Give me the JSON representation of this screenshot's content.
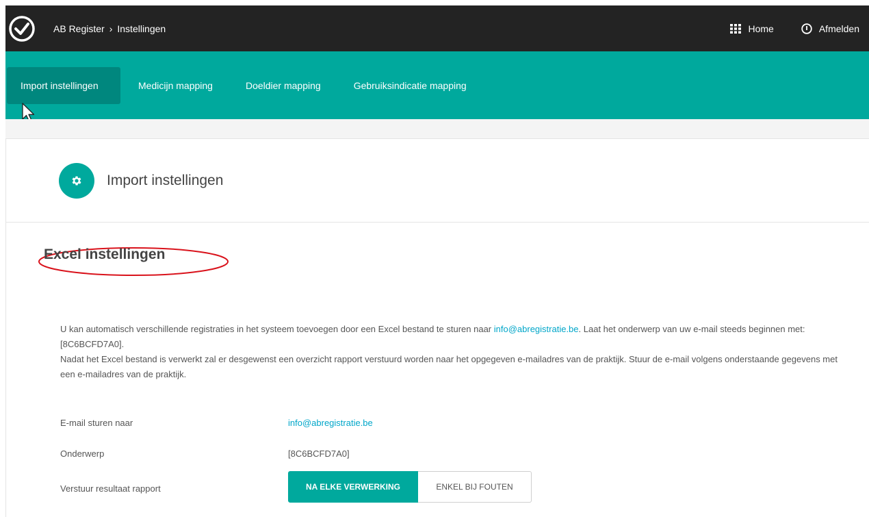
{
  "header": {
    "breadcrumb": [
      "AB Register",
      "Instellingen"
    ],
    "home_label": "Home",
    "logout_label": "Afmelden"
  },
  "nav": {
    "tabs": [
      {
        "label": "Import instellingen",
        "active": true
      },
      {
        "label": "Medicijn mapping",
        "active": false
      },
      {
        "label": "Doeldier mapping",
        "active": false
      },
      {
        "label": "Gebruiksindicatie mapping",
        "active": false
      }
    ]
  },
  "card": {
    "title": "Import instellingen"
  },
  "section": {
    "title": "Excel instellingen",
    "desc_part1": "U kan automatisch verschillende registraties in het systeem toevoegen door een Excel bestand te sturen naar ",
    "desc_email": "info@abregistratie.be",
    "desc_part2": ". Laat het onderwerp van uw e-mail steeds beginnen met: [8C6BCFD7A0].",
    "desc_part3": "Nadat het Excel bestand is verwerkt zal er desgewenst een overzicht rapport verstuurd worden naar het opgegeven e-mailadres van de praktijk. Stuur de e-mail volgens onderstaande gegevens met een e-mailadres van de praktijk."
  },
  "fields": {
    "email_label": "E-mail sturen naar",
    "email_value": "info@abregistratie.be",
    "subject_label": "Onderwerp",
    "subject_value": "[8C6BCFD7A0]",
    "report_label": "Verstuur resultaat rapport",
    "report_options": [
      "NA ELKE VERWERKING",
      "ENKEL BIJ FOUTEN"
    ],
    "report_selected": "NA ELKE VERWERKING"
  },
  "colors": {
    "topbar": "#232323",
    "accent": "#00a99d",
    "accent_dark": "#00877e",
    "link": "#00a6c9",
    "annotation": "#d9121b"
  }
}
